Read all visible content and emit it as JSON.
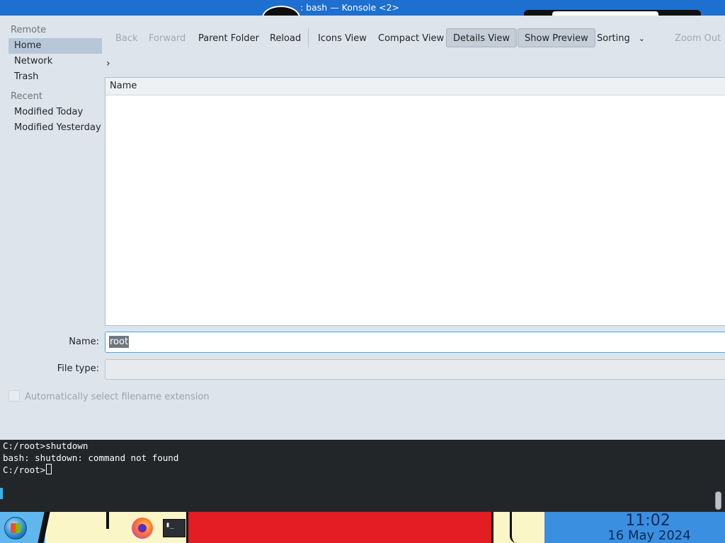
{
  "window": {
    "title": ": bash — Konsole <2>"
  },
  "sidebar": {
    "sections": [
      {
        "heading": "Remote",
        "items": [
          "Home",
          "Network",
          "Trash"
        ]
      },
      {
        "heading": "Recent",
        "items": [
          "Modified Today",
          "Modified Yesterday"
        ]
      }
    ],
    "active_item": "Home"
  },
  "toolbar": {
    "back": "Back",
    "forward": "Forward",
    "parent_folder": "Parent Folder",
    "reload": "Reload",
    "icons_view": "Icons View",
    "compact_view": "Compact View",
    "details_view": "Details View",
    "show_preview": "Show Preview",
    "sorting": "Sorting",
    "zoom_out": "Zoom Out"
  },
  "file_view": {
    "columns": [
      "Name"
    ],
    "rows": []
  },
  "form": {
    "name_label": "Name:",
    "name_value": "root",
    "filetype_label": "File type:",
    "filetype_value": "",
    "auto_extension_label": "Automatically select filename extension",
    "auto_extension_checked": false
  },
  "terminal": {
    "lines": [
      "C:/root>shutdown",
      "bash: shutdown: command not found",
      "C:/root>"
    ]
  },
  "taskbar": {
    "icons": [
      "start-orb-icon",
      "firefox-icon",
      "konsole-icon"
    ],
    "clock_time": "11:02",
    "clock_date": "16 May 2024"
  },
  "colors": {
    "accent": "#3daee9",
    "window_bg": "#dde4ec",
    "terminal_bg": "#232629",
    "taskbar_red": "#e41c23",
    "titlebar_blue": "#1d6fd0"
  }
}
